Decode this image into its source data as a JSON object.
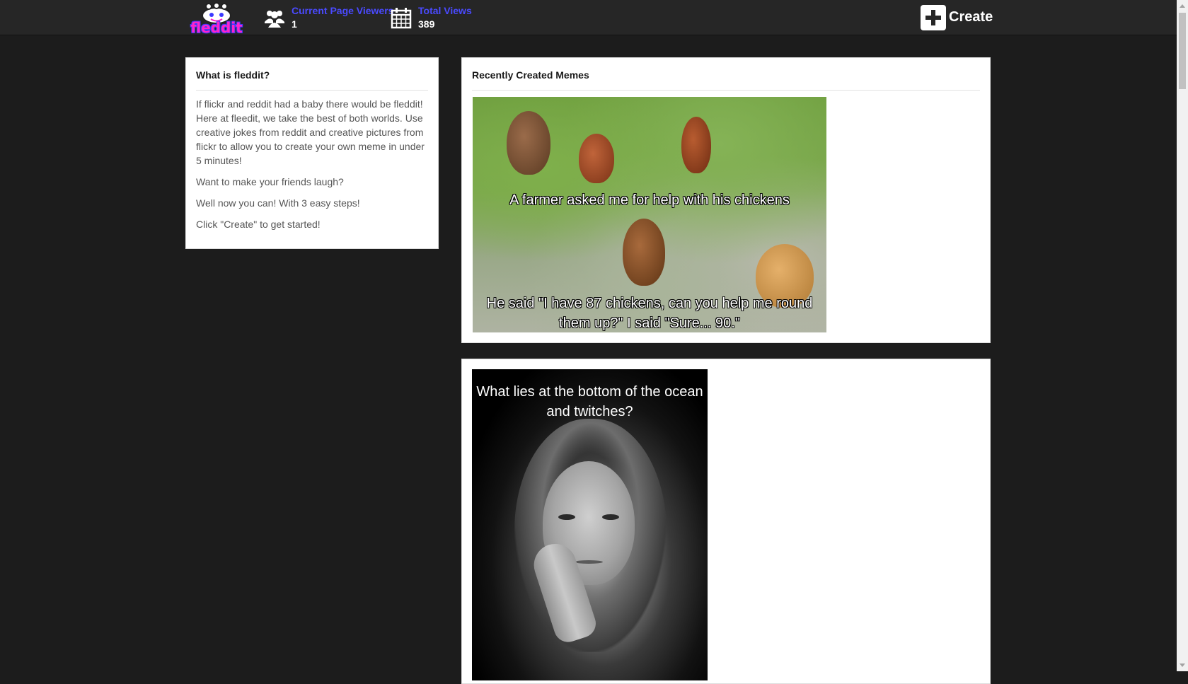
{
  "header": {
    "logo_text": "fleddit",
    "viewers": {
      "label": "Current Page Viewers",
      "value": "1",
      "icon": "users-icon"
    },
    "views": {
      "label": "Total Views",
      "value": "389",
      "icon": "calendar-icon"
    },
    "create_label": "Create",
    "create_icon": "plus-square-icon",
    "link_color": "#4a4aff",
    "background": "#262626"
  },
  "about": {
    "title": "What is fleddit?",
    "paragraphs": [
      "If flickr and reddit had a baby there would be fleddit! Here at fleedit, we take the best of both worlds. Use creative jokes from reddit and creative pictures from flickr to allow you to create your own meme in under 5 minutes!",
      "Want to make your friends laugh?",
      "Well now you can! With 3 easy steps!",
      "Click \"Create\" to get started!"
    ]
  },
  "memes": {
    "title": "Recently Created Memes",
    "items": [
      {
        "top_text": "A farmer asked me for help with his chickens",
        "bottom_text": "He said \"I have 87 chickens, can you help me round them up?\" I said \"Sure... 90.\""
      },
      {
        "top_text": "What lies at the bottom of the ocean and twitches?"
      }
    ]
  }
}
